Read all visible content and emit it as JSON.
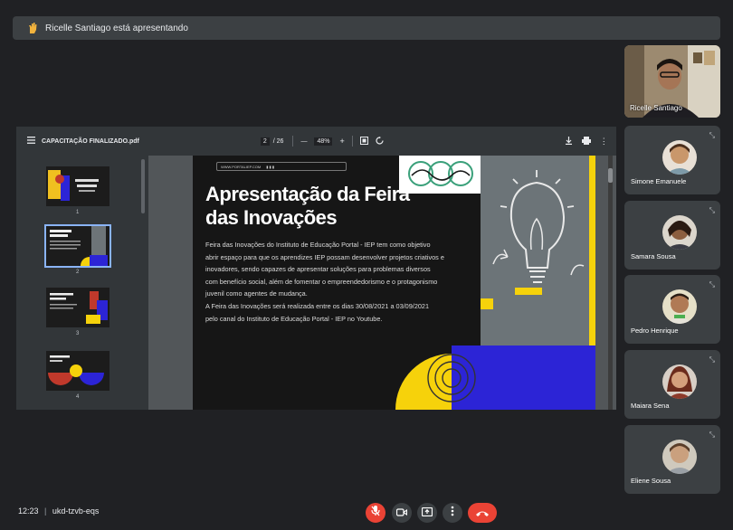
{
  "banner": {
    "text": "Ricelle Santiago está apresentando"
  },
  "self": {
    "name": "Ricelle Santiago"
  },
  "participants": [
    {
      "name": "Simone Emanuele"
    },
    {
      "name": "Samara Sousa"
    },
    {
      "name": "Pedro Henrique"
    },
    {
      "name": "Maiara Sena"
    },
    {
      "name": "Eliene Sousa"
    }
  ],
  "viewer": {
    "filename": "CAPACITAÇÃO FINALIZADO.pdf",
    "page_current": "2",
    "page_total": "/ 26",
    "zoom": "48%",
    "minus": "—",
    "plus": "+",
    "thumb_numbers": [
      "1",
      "2",
      "3",
      "4"
    ]
  },
  "slide": {
    "title_line1": "Apresentação da Feira",
    "title_line2": "das Inovações",
    "body_lines": [
      "Feira das Inovações do Instituto de Educação Portal - IEP tem como objetivo",
      "abrir espaço para que os aprendizes IEP possam desenvolver projetos criativos e",
      "inovadores, sendo capazes de apresentar soluções para problemas diversos",
      "com benefício social, além de fomentar o empreendedorismo e o protagonismo",
      "juvenil como agentes de mudança.",
      "A Feira das Inovações será realizada entre os dias 30/08/2021 a 03/09/2021",
      "pelo canal do Instituto de Educação Portal - IEP no Youtube."
    ],
    "url": "WWW.PORTALIEP.COM"
  },
  "meeting": {
    "time": "12:23",
    "separator": "|",
    "code": "ukd-tzvb-eqs"
  },
  "colors": {
    "end_call": "#ea4335",
    "mic_off": "#ea4335",
    "slide_yellow": "#f6d20b",
    "slide_blue": "#2c24d6"
  }
}
